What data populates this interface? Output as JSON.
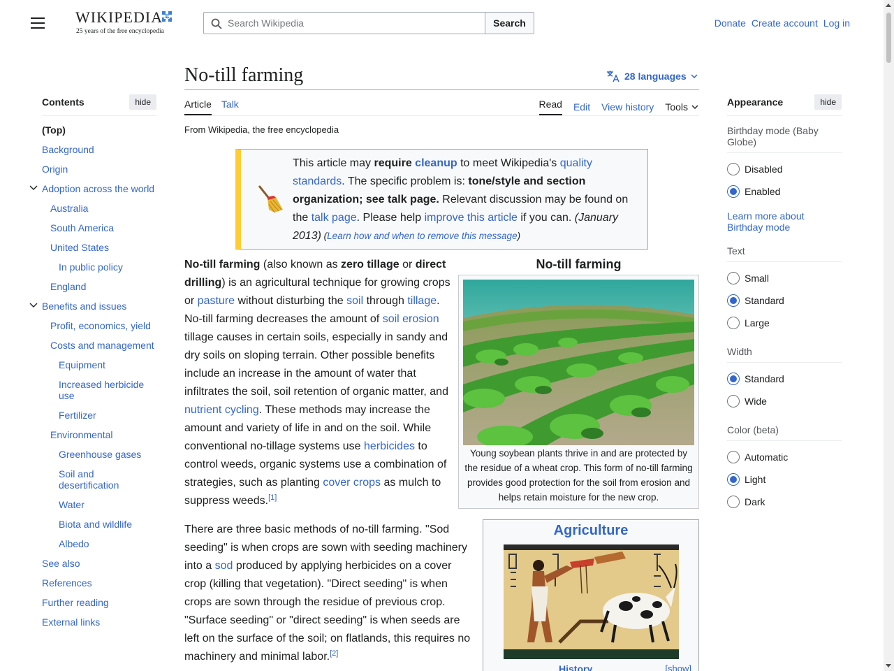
{
  "header": {
    "logo_word": "WIKIPEDIA",
    "logo_badge": "25",
    "tagline": "25 years of the free encyclopedia",
    "search_placeholder": "Search Wikipedia",
    "search_button": "Search",
    "donate": "Donate",
    "create_account": "Create account",
    "log_in": "Log in"
  },
  "toc": {
    "title": "Contents",
    "hide": "hide",
    "items": [
      {
        "label": "(Top)",
        "level": 1
      },
      {
        "label": "Background",
        "level": 1
      },
      {
        "label": "Origin",
        "level": 1
      },
      {
        "label": "Adoption across the world",
        "level": 1
      },
      {
        "label": "Australia",
        "level": 2
      },
      {
        "label": "South America",
        "level": 2
      },
      {
        "label": "United States",
        "level": 2
      },
      {
        "label": "In public policy",
        "level": 3
      },
      {
        "label": "England",
        "level": 2
      },
      {
        "label": "Benefits and issues",
        "level": 1
      },
      {
        "label": "Profit, economics, yield",
        "level": 2
      },
      {
        "label": "Costs and management",
        "level": 2
      },
      {
        "label": "Equipment",
        "level": 3
      },
      {
        "label": "Increased herbicide use",
        "level": 3
      },
      {
        "label": "Fertilizer",
        "level": 3
      },
      {
        "label": "Environmental",
        "level": 2
      },
      {
        "label": "Greenhouse gases",
        "level": 3
      },
      {
        "label": "Soil and desertification",
        "level": 3
      },
      {
        "label": "Water",
        "level": 3
      },
      {
        "label": "Biota and wildlife",
        "level": 3
      },
      {
        "label": "Albedo",
        "level": 3
      },
      {
        "label": "See also",
        "level": 1
      },
      {
        "label": "References",
        "level": 1
      },
      {
        "label": "Further reading",
        "level": 1
      },
      {
        "label": "External links",
        "level": 1
      }
    ]
  },
  "article": {
    "title": "No-till farming",
    "languages": "28 languages",
    "tab_article": "Article",
    "tab_talk": "Talk",
    "tab_read": "Read",
    "tab_edit": "Edit",
    "tab_history": "View history",
    "tab_tools": "Tools",
    "from": "From Wikipedia, the free encyclopedia"
  },
  "notice": {
    "t1": "This article may ",
    "t2": "require",
    "t3": " ",
    "t4": "cleanup",
    "t5": " to meet Wikipedia's ",
    "t6": "quality standards",
    "t7": ". The specific problem is: ",
    "t8": "tone/style and section organization; see talk page.",
    "t9": " Relevant discussion may be found on the ",
    "t10": "talk page",
    "t11": ". Please help ",
    "t12": "improve this article",
    "t13": " if you can. ",
    "t14": "(January 2013)",
    "t15": " (",
    "t16": "Learn how and when to remove this message",
    "t17": ")"
  },
  "p1": {
    "a": "No-till farming",
    "b": " (also known as ",
    "c": "zero tillage",
    "d": " or ",
    "e": "direct drilling",
    "f": ") is an agricultural technique for growing crops or ",
    "g": "pasture",
    "h": " without disturbing the ",
    "i": "soil",
    "j": " through ",
    "k": "tillage",
    "l": ". No-till farming decreases the amount of ",
    "m": "soil erosion",
    "n": " tillage causes in certain soils, especially in sandy and dry soils on sloping terrain. Other possible benefits include an increase in the amount of water that infiltrates the soil, soil retention of organic matter, and ",
    "o": "nutrient cycling",
    "p": ". These methods may increase the amount and variety of life in and on the soil. While conventional no-tillage systems use ",
    "q": "herbicides",
    "r": " to control weeds, organic systems use a combination of strategies, such as planting ",
    "s": "cover crops",
    "t": " as mulch to suppress weeds.",
    "ref": "[1]"
  },
  "p2": {
    "a": "There are three basic methods of no-till farming. \"Sod seeding\" is when crops are sown with seeding machinery into a ",
    "b": "sod",
    "c": " produced by applying herbicides on a cover crop (killing that vegetation). \"Direct seeding\" is when crops are sown through the residue of previous crop. \"Surface seeding\" or \"direct seeding\" is when seeds are left on the surface of the soil; on flatlands, this requires no machinery and minimal labor.",
    "ref": "[2]"
  },
  "infobox1": {
    "title": "No-till farming",
    "caption": "Young soybean plants thrive in and are protected by the residue of a wheat crop. This form of no-till farming provides good protection for the soil from erosion and helps retain moisture for the new crop."
  },
  "infobox2": {
    "title": "Agriculture",
    "history": "History",
    "show": "[show]"
  },
  "appearance": {
    "title": "Appearance",
    "hide": "hide",
    "birthday_title": "Birthday mode (Baby Globe)",
    "disabled": "Disabled",
    "enabled": "Enabled",
    "learn_more": "Learn more about Birthday mode",
    "text_title": "Text",
    "small": "Small",
    "standard": "Standard",
    "large": "Large",
    "width_title": "Width",
    "width_standard": "Standard",
    "wide": "Wide",
    "color_title": "Color (beta)",
    "automatic": "Automatic",
    "light": "Light",
    "dark": "Dark"
  },
  "colors": {
    "link": "#3366cc",
    "notice_bar": "#ffcc33",
    "text": "#202122"
  }
}
